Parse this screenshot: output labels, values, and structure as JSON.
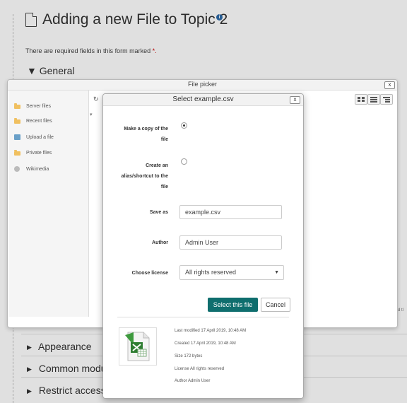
{
  "page": {
    "title": "Adding a new File to Topic 2",
    "info_icon": "i",
    "required_note": "There are required fields in this form marked",
    "required_star": "*.",
    "sections": {
      "general": "General",
      "appearance": "Appearance",
      "common": "Common modul",
      "restrict": "Restrict access"
    },
    "cut_text": "d tl"
  },
  "file_picker": {
    "title": "File picker",
    "close": "x",
    "repositories": [
      {
        "label": "Server files",
        "icon": "folder-icon"
      },
      {
        "label": "Recent files",
        "icon": "folder-icon"
      },
      {
        "label": "Upload a file",
        "icon": "upload-icon"
      },
      {
        "label": "Private files",
        "icon": "folder-icon"
      },
      {
        "label": "Wikimedia",
        "icon": "globe-icon"
      }
    ],
    "refresh_icon": "↻",
    "tree_toggle": "▾"
  },
  "dialog": {
    "title": "Select example.csv",
    "close": "x",
    "copy_label": "Make a copy of the file",
    "alias_label": "Create an alias/shortcut to the file",
    "save_as_label": "Save as",
    "save_as_value": "example.csv",
    "author_label": "Author",
    "author_value": "Admin User",
    "license_label": "Choose license",
    "license_value": "All rights reserved",
    "select_button": "Select this file",
    "cancel_button": "Cancel",
    "meta": {
      "last_modified": "Last modified 17 April 2019, 10:48 AM",
      "created": "Created 17 April 2019, 10:48 AM",
      "size": "Size 172 bytes",
      "license": "License All rights reserved",
      "author": "Author Admin User"
    }
  },
  "colors": {
    "primary_button": "#0f6e6e",
    "info_badge": "#2e6aa8",
    "required_star": "#cc0000"
  }
}
